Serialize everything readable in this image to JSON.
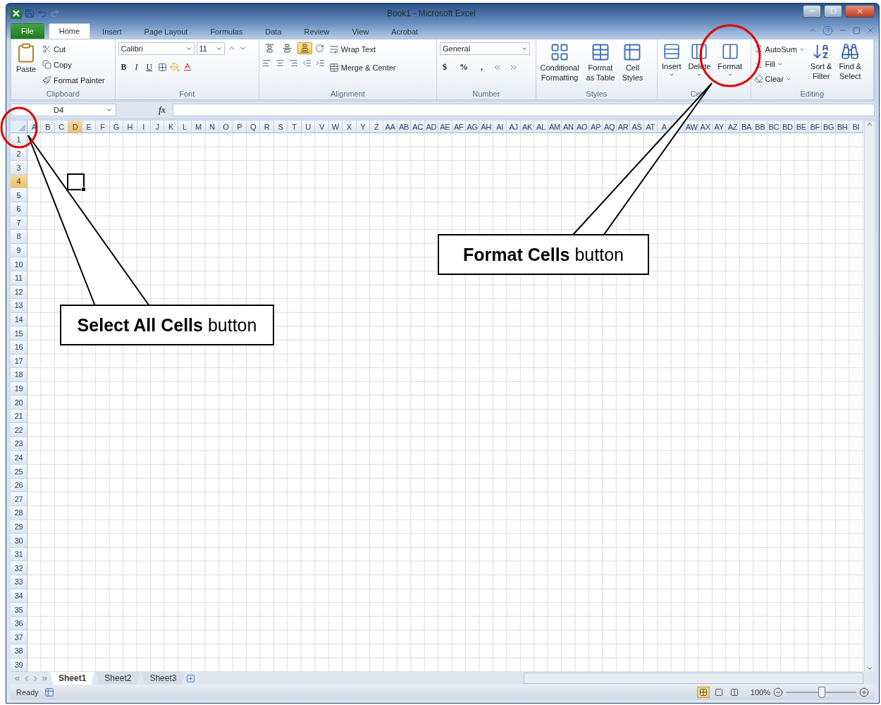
{
  "window": {
    "title": "Book1  -  Microsoft Excel"
  },
  "tabs": [
    {
      "label": "File",
      "kind": "file",
      "selected": false
    },
    {
      "label": "Home",
      "kind": "tab",
      "selected": true
    },
    {
      "label": "Insert",
      "kind": "tab",
      "selected": false
    },
    {
      "label": "Page Layout",
      "kind": "tab",
      "selected": false
    },
    {
      "label": "Formulas",
      "kind": "tab",
      "selected": false
    },
    {
      "label": "Data",
      "kind": "tab",
      "selected": false
    },
    {
      "label": "Review",
      "kind": "tab",
      "selected": false
    },
    {
      "label": "View",
      "kind": "tab",
      "selected": false
    },
    {
      "label": "Acrobat",
      "kind": "tab",
      "selected": false
    }
  ],
  "ribbon": {
    "groups": [
      {
        "kind": "clipboard",
        "label": "Clipboard",
        "big": "Paste",
        "small": [
          "Cut",
          "Copy",
          "Format Painter"
        ]
      },
      {
        "kind": "font",
        "label": "Font",
        "font_name": "Calibri",
        "font_size": "11",
        "format_buttons": [
          "B",
          "I",
          "U"
        ]
      },
      {
        "kind": "alignment",
        "label": "Alignment",
        "vertical_align": [
          {
            "selected": false
          },
          {
            "selected": false
          },
          {
            "selected": true
          }
        ],
        "wrap": "Wrap Text",
        "merge": "Merge & Center"
      },
      {
        "kind": "number",
        "label": "Number",
        "format": "General",
        "symbols": [
          "$",
          "%",
          ","
        ]
      },
      {
        "kind": "styles",
        "label": "Styles",
        "buttons": [
          {
            "lines": [
              "Conditional",
              "Formatting"
            ]
          },
          {
            "lines": [
              "Format",
              "as Table"
            ]
          },
          {
            "lines": [
              "Cell",
              "Styles"
            ]
          }
        ]
      },
      {
        "kind": "cells",
        "label": "Cel",
        "buttons": [
          "Insert",
          "Delete",
          "Format"
        ]
      },
      {
        "kind": "editing",
        "label": "Editing",
        "small": [
          "AutoSum",
          "Fill",
          "Clear"
        ],
        "big": [
          {
            "lines": [
              "Sort &",
              "Filter"
            ]
          },
          {
            "lines": [
              "Find &",
              "Select"
            ]
          }
        ]
      }
    ]
  },
  "formula_bar": {
    "name_box": "D4",
    "function_label": "fx"
  },
  "columns": [
    {
      "label": "A",
      "selected": false
    },
    {
      "label": "B",
      "selected": false
    },
    {
      "label": "C",
      "selected": false
    },
    {
      "label": "D",
      "selected": true
    },
    {
      "label": "E",
      "selected": false
    },
    {
      "label": "F",
      "selected": false
    },
    {
      "label": "G",
      "selected": false
    },
    {
      "label": "H",
      "selected": false
    },
    {
      "label": "I",
      "selected": false
    },
    {
      "label": "J",
      "selected": false
    },
    {
      "label": "K",
      "selected": false
    },
    {
      "label": "L",
      "selected": false
    },
    {
      "label": "M",
      "selected": false
    },
    {
      "label": "N",
      "selected": false
    },
    {
      "label": "O",
      "selected": false
    },
    {
      "label": "P",
      "selected": false
    },
    {
      "label": "Q",
      "selected": false
    },
    {
      "label": "R",
      "selected": false
    },
    {
      "label": "S",
      "selected": false
    },
    {
      "label": "T",
      "selected": false
    },
    {
      "label": "U",
      "selected": false
    },
    {
      "label": "V",
      "selected": false
    },
    {
      "label": "W",
      "selected": false
    },
    {
      "label": "X",
      "selected": false
    },
    {
      "label": "Y",
      "selected": false
    },
    {
      "label": "Z",
      "selected": false
    },
    {
      "label": "AA",
      "selected": false
    },
    {
      "label": "AB",
      "selected": false
    },
    {
      "label": "AC",
      "selected": false
    },
    {
      "label": "AD",
      "selected": false
    },
    {
      "label": "AE",
      "selected": false
    },
    {
      "label": "AF",
      "selected": false
    },
    {
      "label": "AG",
      "selected": false
    },
    {
      "label": "AH",
      "selected": false
    },
    {
      "label": "AI",
      "selected": false
    },
    {
      "label": "AJ",
      "selected": false
    },
    {
      "label": "AK",
      "selected": false
    },
    {
      "label": "AL",
      "selected": false
    },
    {
      "label": "AM",
      "selected": false
    },
    {
      "label": "AN",
      "selected": false
    },
    {
      "label": "AO",
      "selected": false
    },
    {
      "label": "AP",
      "selected": false
    },
    {
      "label": "AQ",
      "selected": false
    },
    {
      "label": "AR",
      "selected": false
    },
    {
      "label": "AS",
      "selected": false
    },
    {
      "label": "AT",
      "selected": false
    },
    {
      "label": "A",
      "selected": false
    },
    {
      "selected": false
    },
    {
      "label": "AW",
      "selected": false
    },
    {
      "label": "AX",
      "selected": false
    },
    {
      "label": "AY",
      "selected": false
    },
    {
      "label": "AZ",
      "selected": false
    },
    {
      "label": "BA",
      "selected": false
    },
    {
      "label": "BB",
      "selected": false
    },
    {
      "label": "BC",
      "selected": false
    },
    {
      "label": "BD",
      "selected": false
    },
    {
      "label": "BE",
      "selected": false
    },
    {
      "label": "BF",
      "selected": false
    },
    {
      "label": "BG",
      "selected": false
    },
    {
      "label": "BH",
      "selected": false
    },
    {
      "label": "BI",
      "selected": false
    }
  ],
  "rows": [
    {
      "label": "1",
      "selected": false
    },
    {
      "label": "2",
      "selected": false
    },
    {
      "label": "3",
      "selected": false
    },
    {
      "label": "4",
      "selected": true
    },
    {
      "label": "5",
      "selected": false
    },
    {
      "label": "6",
      "selected": false
    },
    {
      "label": "7",
      "selected": false
    },
    {
      "label": "8",
      "selected": false
    },
    {
      "label": "9",
      "selected": false
    },
    {
      "label": "10",
      "selected": false
    },
    {
      "label": "11",
      "selected": false
    },
    {
      "label": "12",
      "selected": false
    },
    {
      "label": "13",
      "selected": false
    },
    {
      "label": "14",
      "selected": false
    },
    {
      "label": "15",
      "selected": false
    },
    {
      "label": "16",
      "selected": false
    },
    {
      "label": "17",
      "selected": false
    },
    {
      "label": "18",
      "selected": false
    },
    {
      "label": "19",
      "selected": false
    },
    {
      "label": "20",
      "selected": false
    },
    {
      "label": "21",
      "selected": false
    },
    {
      "label": "22",
      "selected": false
    },
    {
      "label": "23",
      "selected": false
    },
    {
      "label": "24",
      "selected": false
    },
    {
      "label": "25",
      "selected": false
    },
    {
      "label": "26",
      "selected": false
    },
    {
      "label": "27",
      "selected": false
    },
    {
      "label": "28",
      "selected": false
    },
    {
      "label": "29",
      "selected": false
    },
    {
      "label": "30",
      "selected": false
    },
    {
      "label": "31",
      "selected": false
    },
    {
      "label": "32",
      "selected": false
    },
    {
      "label": "33",
      "selected": false
    },
    {
      "label": "34",
      "selected": false
    },
    {
      "label": "35",
      "selected": false
    },
    {
      "label": "36",
      "selected": false
    },
    {
      "label": "37",
      "selected": false
    },
    {
      "label": "38",
      "selected": false
    },
    {
      "label": "39",
      "selected": false
    }
  ],
  "sheet_tabs": [
    {
      "label": "Sheet1",
      "selected": true
    },
    {
      "label": "Sheet2",
      "selected": false
    },
    {
      "label": "Sheet3",
      "selected": false
    }
  ],
  "status_bar": {
    "status": "Ready",
    "views": [
      {
        "selected": true
      },
      {
        "selected": false
      },
      {
        "selected": false
      }
    ],
    "zoom": "100%",
    "zoom_slider": {
      "level": 0.5
    }
  },
  "callouts": [
    {
      "text": "**Select All Cells** button"
    },
    {
      "text": "**Format Cells** button"
    }
  ]
}
